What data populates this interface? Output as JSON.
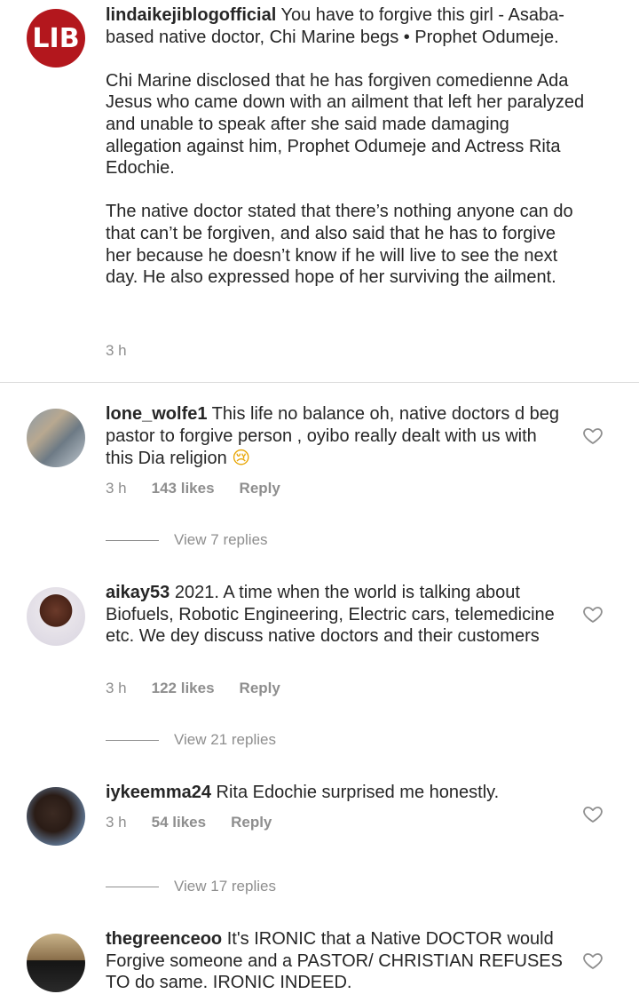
{
  "caption": {
    "avatar_text": "LIB",
    "username": "lindaikejiblogofficial",
    "text": " You have to forgive this girl - Asaba-based native doctor, Chi Marine begs • Prophet Odumeje.\n\nChi Marine disclosed that he has forgiven comedienne Ada Jesus who came down with an ailment that left her paralyzed and unable to speak after she said made damaging allegation against him, Prophet Odumeje and Actress Rita Edochie.\n\nThe native doctor stated that there’s nothing anyone can do that can’t be forgiven, and also said that he has to forgive her because he doesn’t know if he will live to see the next day. He also expressed hope of her surviving the ailment.",
    "time": "3 h"
  },
  "comments": [
    {
      "username": "lone_wolfe1",
      "text": " This life no balance oh, native doctors d beg pastor to forgive person , oyibo really dealt with us with this Dia religion ",
      "emoji": "😢",
      "time": "3 h",
      "likes": "143 likes",
      "reply": "Reply",
      "view_replies": "View 7 replies"
    },
    {
      "username": "aikay53",
      "text": " 2021. A time when the world is talking about Biofuels, Robotic Engineering, Electric cars, telemedicine etc. We dey discuss native doctors and their customers",
      "time": "3 h",
      "likes": "122 likes",
      "reply": "Reply",
      "view_replies": "View 21 replies"
    },
    {
      "username": "iykeemma24",
      "text": " Rita Edochie surprised me honestly.",
      "time": "3 h",
      "likes": "54 likes",
      "reply": "Reply",
      "view_replies": "View 17 replies"
    },
    {
      "username": "thegreenceoo",
      "text": " It's IRONIC that a Native DOCTOR would Forgive someone and a PASTOR/ CHRISTIAN REFUSES TO do same. IRONIC INDEED."
    }
  ],
  "icons": {
    "like": "heart-outline-icon"
  },
  "colors": {
    "logo_red": "#b3171d",
    "muted": "#8e8e8e",
    "text": "#262626"
  }
}
